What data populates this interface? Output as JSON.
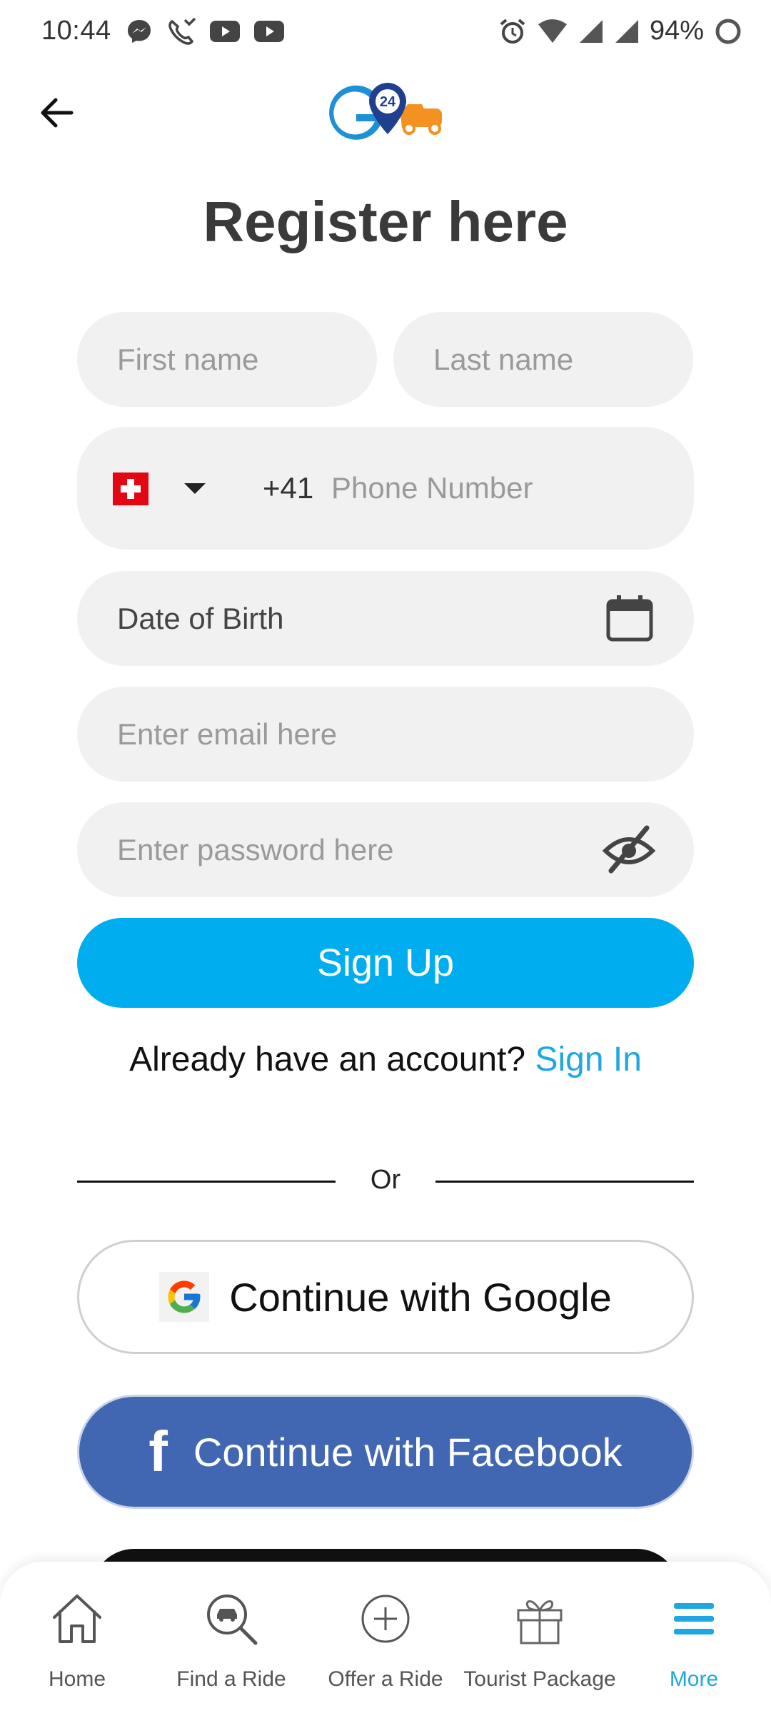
{
  "status_bar": {
    "time": "10:44",
    "battery": "94%",
    "left_icons": [
      "messenger-icon",
      "missed-call-icon",
      "youtube-icon",
      "youtube-icon"
    ],
    "right_icons": [
      "alarm-icon",
      "wifi-icon",
      "signal-icon",
      "signal-icon",
      "battery-icon"
    ]
  },
  "header": {
    "back_icon": "arrow-left-icon",
    "logo_text": "24",
    "title": "Register here"
  },
  "form": {
    "first_name_placeholder": "First name",
    "last_name_placeholder": "Last name",
    "phone": {
      "country_flag": "switzerland-flag",
      "dial_code": "+41",
      "placeholder": "Phone Number"
    },
    "dob_label": "Date of Birth",
    "email_placeholder": "Enter email here",
    "password_placeholder": "Enter password here",
    "signup_label": "Sign Up"
  },
  "account_prompt": {
    "text": "Already have an account?",
    "link": "Sign In"
  },
  "divider_text": "Or",
  "social": {
    "google_label": "Continue with Google",
    "facebook_label": "Continue with Facebook",
    "facebook_icon_glyph": "f"
  },
  "bottom_nav": {
    "items": [
      {
        "label": "Home",
        "icon": "home-icon"
      },
      {
        "label": "Find a Ride",
        "icon": "search-car-icon"
      },
      {
        "label": "Offer a Ride",
        "icon": "plus-circle-icon"
      },
      {
        "label": "Tourist Package",
        "icon": "gift-icon"
      },
      {
        "label": "More",
        "icon": "menu-icon"
      }
    ],
    "active_index": 4
  },
  "colors": {
    "accent": "#00aeef",
    "link": "#1ea7e0",
    "facebook": "#4267b2",
    "input_bg": "#f1f1f1",
    "title": "#3a3a3a"
  }
}
